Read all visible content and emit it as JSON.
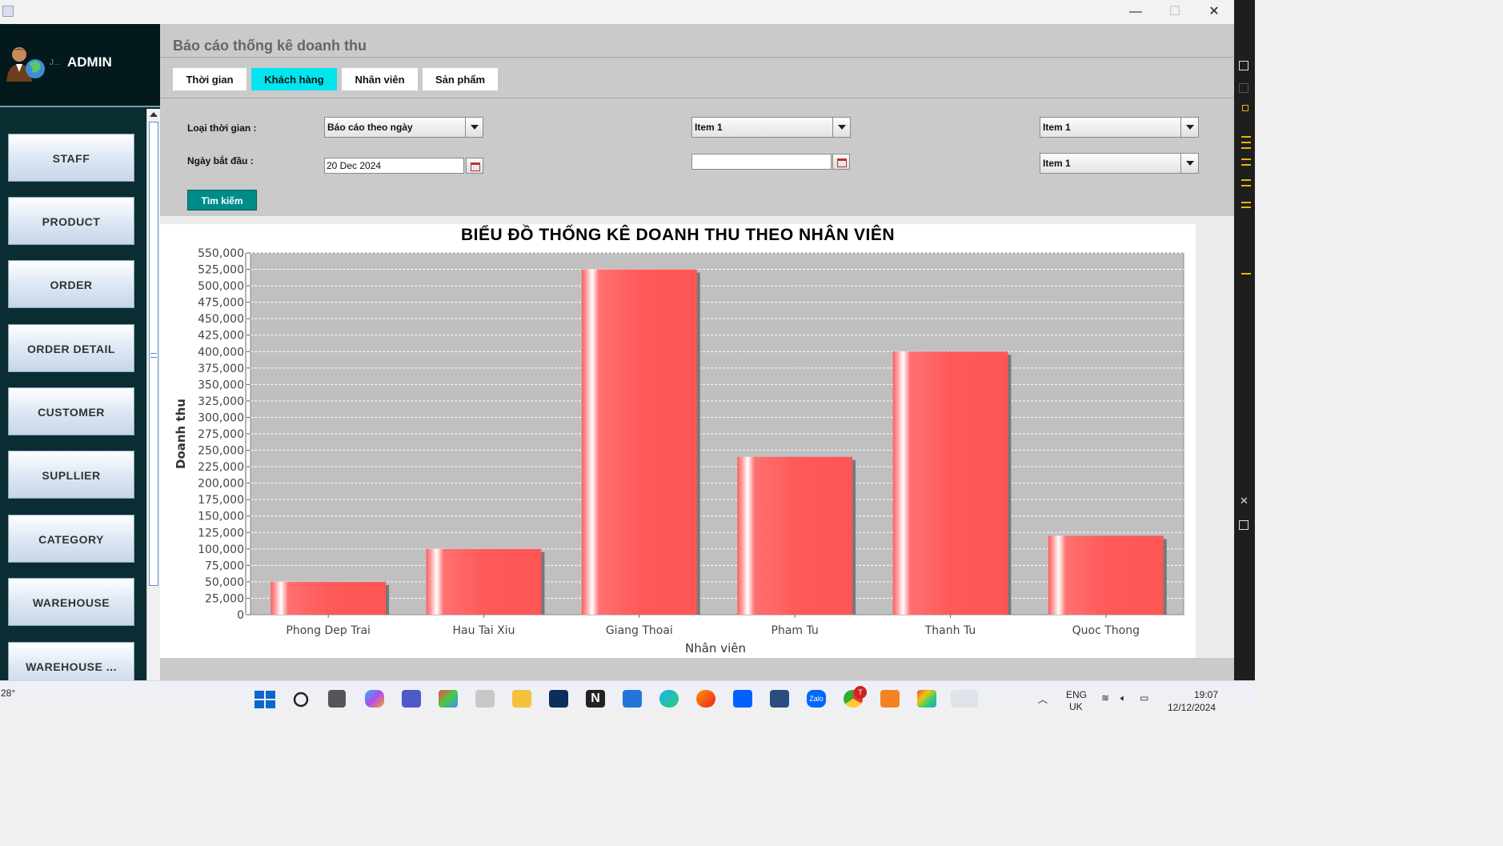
{
  "window": {
    "minimize": "—",
    "maximize": "☐",
    "close": "✕"
  },
  "sidebar": {
    "admin_label": "ADMIN",
    "admin_sub": "J...",
    "items": [
      {
        "label": "STAFF"
      },
      {
        "label": "PRODUCT"
      },
      {
        "label": "ORDER"
      },
      {
        "label": "ORDER DETAIL"
      },
      {
        "label": "CUSTOMER"
      },
      {
        "label": "SUPLLIER"
      },
      {
        "label": "CATEGORY"
      },
      {
        "label": "WAREHOUSE"
      },
      {
        "label": "WAREHOUSE ..."
      }
    ]
  },
  "main": {
    "page_title": "Báo cáo thống kê doanh thu",
    "tabs": [
      {
        "label": "Thời gian",
        "active": false
      },
      {
        "label": "Khách hàng",
        "active": true
      },
      {
        "label": "Nhân viên",
        "active": false
      },
      {
        "label": "Sản phẩm",
        "active": false
      }
    ],
    "filters": {
      "time_type_label": "Loại thời gian :",
      "time_type_value": "Báo cáo theo ngày",
      "start_date_label": "Ngày bắt đầu :",
      "start_date_value": "20 Dec 2024",
      "combo_mid_value": "Item 1",
      "date_mid_value": "",
      "combo_right_1_value": "Item 1",
      "combo_right_2_value": "Item 1"
    },
    "search_button": "Tìm kiếm"
  },
  "chart_data": {
    "type": "bar",
    "title": "BIỂU ĐỒ THỐNG KÊ DOANH THU THEO NHÂN VIÊN",
    "xlabel": "Nhân viên",
    "ylabel": "Doanh thu",
    "categories": [
      "Phong Dep Trai",
      "Hau Tai Xiu",
      "Giang Thoai",
      "Pham Tu",
      "Thanh Tu",
      "Quoc Thong"
    ],
    "values": [
      50000,
      100000,
      525000,
      240000,
      400000,
      120000
    ],
    "ylim": [
      0,
      550000
    ],
    "yticks": [
      "0",
      "25,000",
      "50,000",
      "75,000",
      "100,000",
      "125,000",
      "150,000",
      "175,000",
      "200,000",
      "225,000",
      "250,000",
      "275,000",
      "300,000",
      "325,000",
      "350,000",
      "375,000",
      "400,000",
      "425,000",
      "450,000",
      "475,000",
      "500,000",
      "525,000",
      "550,000"
    ],
    "grid": true,
    "bar_color": "#ff5555",
    "plot_background": "#c0c0c0"
  },
  "taskbar": {
    "temperature": "28°",
    "language": "ENG",
    "region": "UK",
    "time": "19:07",
    "date": "12/12/2024",
    "teams_badge": "T"
  }
}
